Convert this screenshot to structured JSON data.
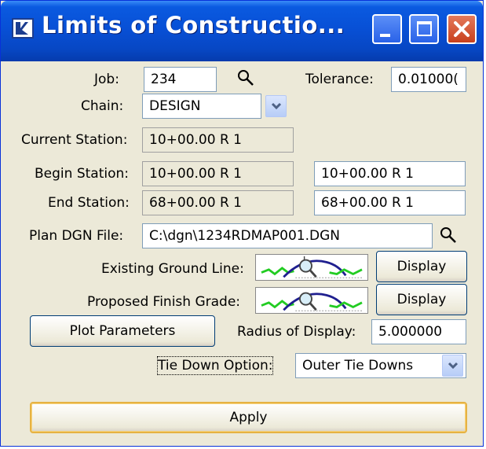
{
  "window": {
    "title": "Limits of Constructio..."
  },
  "form": {
    "job_label": "Job:",
    "job_value": "234",
    "tolerance_label": "Tolerance:",
    "tolerance_value": "0.01000(",
    "chain_label": "Chain:",
    "chain_value": "DESIGN",
    "current_station_label": "Current Station:",
    "current_station_value": "10+00.00 R 1",
    "begin_station_label": "Begin Station:",
    "begin_station_current": "10+00.00 R 1",
    "begin_station_value": "10+00.00 R 1",
    "end_station_label": "End Station:",
    "end_station_current": "68+00.00 R 1",
    "end_station_value": "68+00.00 R 1",
    "plan_dgn_label": "Plan DGN File:",
    "plan_dgn_value": "C:\\dgn\\1234RDMAP001.DGN",
    "existing_ground_label": "Existing Ground Line:",
    "proposed_finish_label": "Proposed Finish Grade:",
    "display_label": "Display",
    "plot_parameters_label": "Plot Parameters",
    "radius_label": "Radius of Display:",
    "radius_value": "5.000000",
    "tie_down_label": "Tie Down Option:",
    "tie_down_value": "Outer Tie Downs",
    "apply_label": "Apply"
  },
  "colors": {
    "titlebar": "#0850d6",
    "dialog_bg": "#ece9d8",
    "close_button": "#c8401d",
    "profile_line": "#1f1f8f",
    "ground_line": "#22cc22"
  }
}
